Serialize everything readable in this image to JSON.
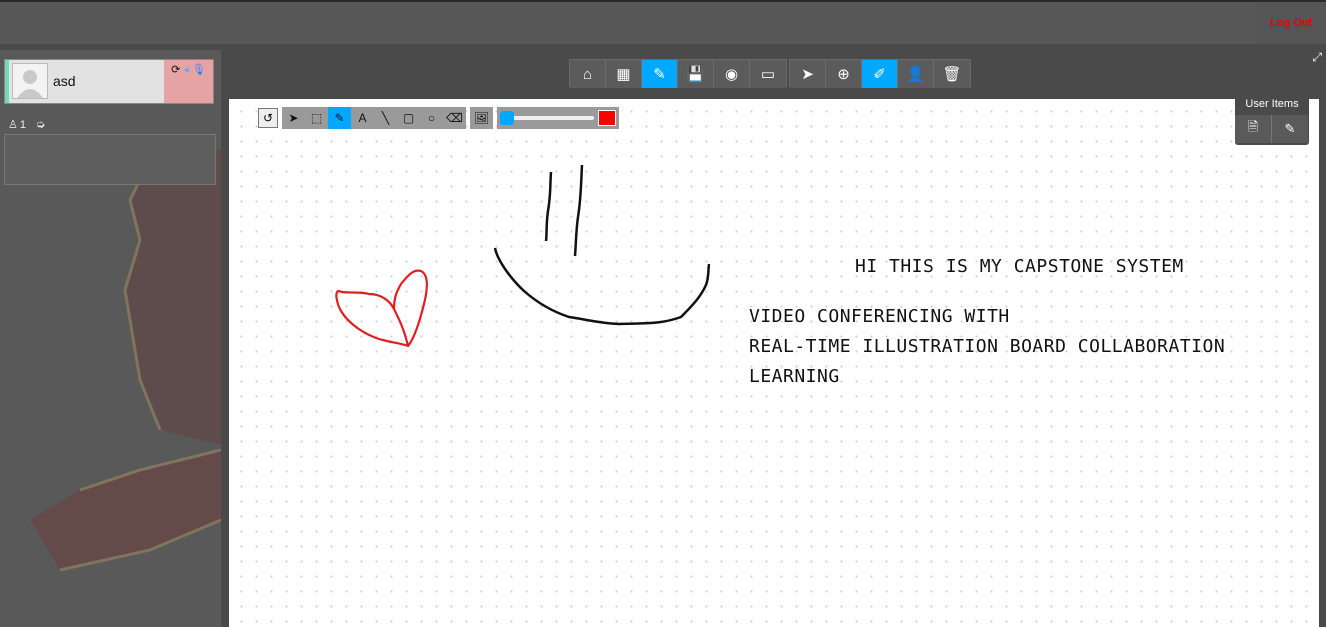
{
  "header": {
    "logout_label": "Log Out",
    "logout_color": "#ff0000"
  },
  "participants": [
    {
      "name": "asd",
      "status_strip_color": "#6fdcb8",
      "controls_bg": "#e5a3a3"
    }
  ],
  "left_panel": {
    "participant_count": "1"
  },
  "main_toolbar": {
    "buttons": [
      {
        "icon": "home-icon",
        "glyph": "⌂"
      },
      {
        "icon": "grid-icon",
        "glyph": "▦"
      },
      {
        "icon": "edit-icon",
        "glyph": "✎",
        "active": true
      },
      {
        "icon": "save-icon",
        "glyph": "💾"
      },
      {
        "icon": "disc-icon",
        "glyph": "◉"
      },
      {
        "icon": "monitor-icon",
        "glyph": "▭"
      },
      {
        "icon": "pointer-icon",
        "glyph": "➤"
      },
      {
        "icon": "zoom-icon",
        "glyph": "⊕"
      },
      {
        "icon": "annotate-icon",
        "glyph": "✐",
        "active": true
      },
      {
        "icon": "add-user-icon",
        "glyph": "👤"
      },
      {
        "icon": "trash-icon",
        "glyph": "🗑"
      }
    ],
    "accent": "#00a8ff"
  },
  "drawing_toolbar": {
    "tools": [
      {
        "icon": "select-arrow-icon",
        "glyph": "➤"
      },
      {
        "icon": "marquee-icon",
        "glyph": "⬚"
      },
      {
        "icon": "pencil-icon",
        "glyph": "✎",
        "active": true
      },
      {
        "icon": "text-icon",
        "glyph": "A"
      },
      {
        "icon": "line-icon",
        "glyph": "╲"
      },
      {
        "icon": "rectangle-icon",
        "glyph": "▢"
      },
      {
        "icon": "circle-icon",
        "glyph": "○"
      },
      {
        "icon": "eraser-icon",
        "glyph": "⌫"
      }
    ],
    "stroke_width_level": 0.0,
    "stroke_color": "#ff0000"
  },
  "board": {
    "text_lines": [
      "HI THIS IS MY CAPSTONE SYSTEM",
      "VIDEO CONFERENCING WITH",
      "REAL-TIME ILLUSTRATION BOARD COLLABORATION",
      "LEARNING"
    ]
  },
  "user_items": {
    "title": "User Items"
  }
}
